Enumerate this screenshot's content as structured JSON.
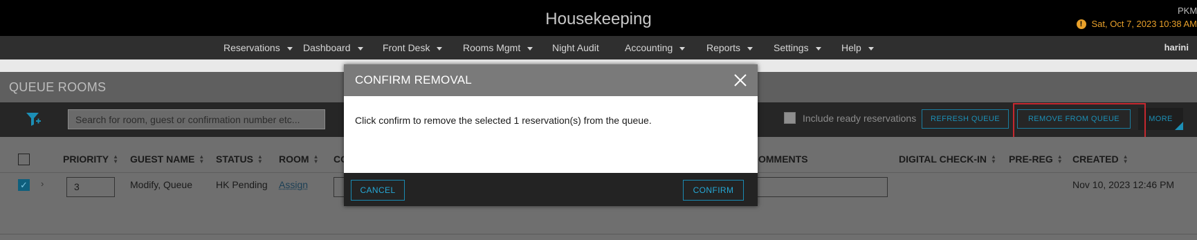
{
  "header": {
    "title": "Housekeeping",
    "user_abbr": "PKM",
    "datetime": "Sat, Oct 7, 2023 10:38 AM",
    "warning_glyph": "!"
  },
  "nav": {
    "items": [
      {
        "label": "Reservations",
        "dropdown": true
      },
      {
        "label": "Dashboard",
        "dropdown": true
      },
      {
        "label": "Front Desk",
        "dropdown": true
      },
      {
        "label": "Rooms Mgmt",
        "dropdown": true
      },
      {
        "label": "Night Audit",
        "dropdown": false
      },
      {
        "label": "Accounting",
        "dropdown": true
      },
      {
        "label": "Reports",
        "dropdown": true
      },
      {
        "label": "Settings",
        "dropdown": true
      },
      {
        "label": "Help",
        "dropdown": true
      }
    ],
    "user": "harini"
  },
  "page": {
    "section_title": "QUEUE ROOMS"
  },
  "toolbar": {
    "search_placeholder": "Search for room, guest or confirmation number etc...",
    "include_ready_label": "Include ready reservations",
    "refresh_label": "REFRESH QUEUE",
    "remove_label": "REMOVE FROM QUEUE",
    "more_label": "MORE"
  },
  "table": {
    "columns": {
      "priority": "PRIORITY",
      "guest_name": "GUEST NAME",
      "status": "STATUS",
      "room": "ROOM",
      "co": "CO",
      "comments": "OMMENTS",
      "digital_checkin": "DIGITAL CHECK-IN",
      "pre_reg": "PRE-REG",
      "created": "CREATED"
    },
    "rows": [
      {
        "checked": true,
        "priority": "3",
        "guest_name": "Modify, Queue",
        "status": "HK Pending",
        "room": "Assign",
        "created": "Nov 10, 2023 12:46 PM"
      }
    ]
  },
  "modal": {
    "title": "CONFIRM REMOVAL",
    "message": "Click confirm to remove the selected 1 reservation(s) from the queue.",
    "cancel_label": "CANCEL",
    "confirm_label": "CONFIRM"
  },
  "colors": {
    "accent": "#1c8fb6",
    "warning": "#e8a02a",
    "highlight": "#c6282f"
  }
}
